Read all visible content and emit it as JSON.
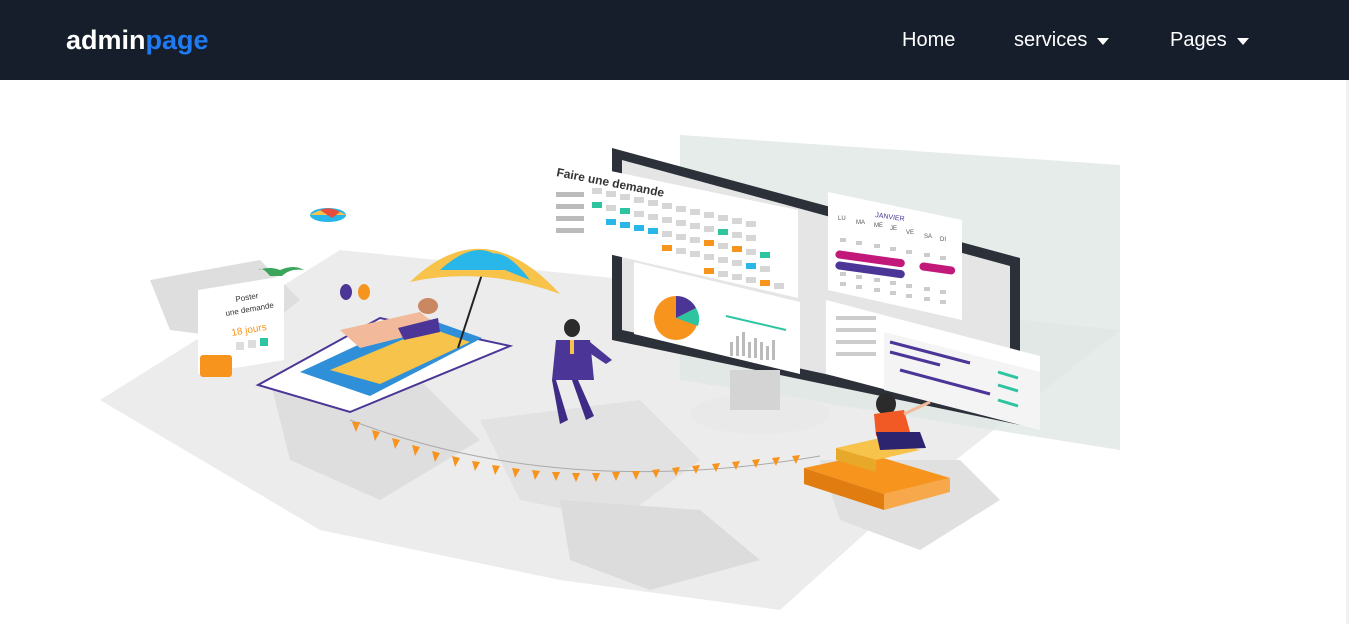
{
  "navbar": {
    "brand_part1": "admin",
    "brand_part2": "page",
    "links": [
      {
        "label": "Home",
        "has_dropdown": false
      },
      {
        "label": "services",
        "has_dropdown": true
      },
      {
        "label": "Pages",
        "has_dropdown": true
      }
    ]
  },
  "hero": {
    "request_card_title": "Faire une demande",
    "calendar_month": "JANVIER",
    "calendar_weekdays": [
      "LU",
      "MA",
      "ME",
      "JE",
      "VE",
      "SA",
      "DI"
    ],
    "calendar_numbers": [
      "5",
      "6",
      "7",
      "1",
      "2",
      "3",
      "4",
      "12",
      "13",
      "14",
      "15",
      "8",
      "9",
      "10",
      "11",
      "19",
      "20",
      "21",
      "22",
      "16",
      "17",
      "18",
      "26",
      "27",
      "28",
      "29",
      "23",
      "24",
      "25",
      "30",
      "31"
    ],
    "poster_line1": "Poster",
    "poster_line2": "une demande",
    "poster_days": "18 jours"
  },
  "colors": {
    "navbar_bg": "#161d2b",
    "brand_accent": "#1f7bf2",
    "orange": "#f7941d",
    "purple": "#4b3596",
    "teal": "#2ec4a0",
    "magenta": "#c2187a",
    "cyan": "#29b6e8"
  }
}
